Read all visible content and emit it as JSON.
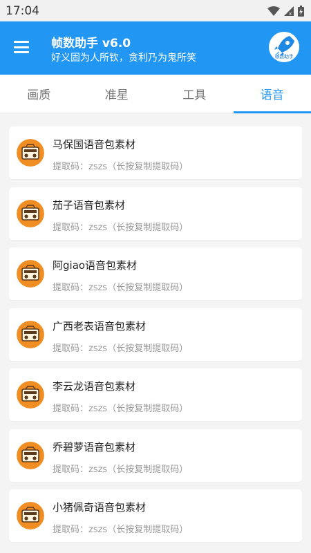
{
  "status_bar": {
    "time": "17:04",
    "icons": [
      "wifi-icon",
      "signal-icon",
      "battery-icon"
    ]
  },
  "app_bar": {
    "menu_icon": "hamburger-menu-icon",
    "title": "帧数助手 v6.0",
    "subtitle": "好义固为人所钦，贪利乃为鬼所笑",
    "logo_text": "帧数助手",
    "color": "#2196f3"
  },
  "tabs": [
    {
      "label": "画质",
      "active": false
    },
    {
      "label": "准星",
      "active": false
    },
    {
      "label": "工具",
      "active": false
    },
    {
      "label": "语音",
      "active": true
    }
  ],
  "voice_packs": [
    {
      "title": "马保国语音包素材",
      "code": "提取码：zszs（长按复制提取码）",
      "icon": "radio-icon"
    },
    {
      "title": "茄子语音包素材",
      "code": "提取码：zszs（长按复制提取码）",
      "icon": "radio-icon"
    },
    {
      "title": "阿giao语音包素材",
      "code": "提取码：zszs（长按复制提取码）",
      "icon": "radio-icon"
    },
    {
      "title": "广西老表语音包素材",
      "code": "提取码：zszs（长按复制提取码）",
      "icon": "radio-icon"
    },
    {
      "title": "李云龙语音包素材",
      "code": "提取码：zszs（长按复制提取码）",
      "icon": "radio-icon"
    },
    {
      "title": "乔碧萝语音包素材",
      "code": "提取码：zszs（长按复制提取码）",
      "icon": "radio-icon"
    },
    {
      "title": "小猪佩奇语音包素材",
      "code": "提取码：zszs（长按复制提取码）",
      "icon": "radio-icon"
    }
  ]
}
